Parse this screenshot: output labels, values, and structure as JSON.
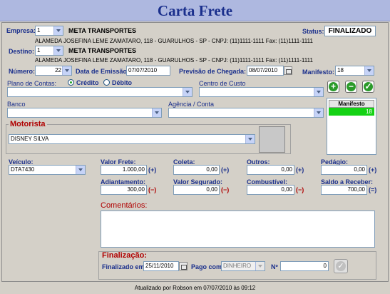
{
  "header": {
    "title": "Carta Frete"
  },
  "status": {
    "label": "Status:",
    "value": "FINALIZADO"
  },
  "empresa": {
    "label": "Empresa:",
    "code": "1",
    "name": "META TRANSPORTES",
    "address": "ALAMEDA JOSEFINA LEME ZAMATARO, 118 - GUARULHOS - SP - CNPJ: (11)1111-1111 Fax: (11)1111-1111"
  },
  "destino": {
    "label": "Destino:",
    "code": "1",
    "name": "META TRANSPORTES",
    "address": "ALAMEDA JOSEFINA LEME ZAMATARO, 118 - GUARULHOS - SP - CNPJ: (11)1111-1111 Fax: (11)1111-1111"
  },
  "numero": {
    "label": "Número:",
    "value": "22"
  },
  "emissao": {
    "label": "Data de Emissão:",
    "value": "07/07/2010"
  },
  "previsao": {
    "label": "Previsão de Chegada:",
    "value": "08/07/2010"
  },
  "manifesto_field": {
    "label": "Manifesto:",
    "value": "18"
  },
  "plano": {
    "label": "Plano de Contas:",
    "credito": "Crédito",
    "debito": "Débito",
    "selected": "Crédito",
    "value": ""
  },
  "centro": {
    "label": "Centro de Custo",
    "value": ""
  },
  "banco": {
    "label": "Banco",
    "value": ""
  },
  "agencia": {
    "label": "Agência / Conta",
    "value": ""
  },
  "manifesto_list": {
    "header": "Manifesto",
    "rows": [
      "18"
    ]
  },
  "motorista": {
    "title": "Motorista",
    "value": "DISNEY SILVA"
  },
  "veiculo": {
    "label": "Veículo:",
    "value": "DTA7430"
  },
  "valor_frete": {
    "label": "Valor Frete:",
    "value": "1.000,00",
    "op": "(+)"
  },
  "coleta": {
    "label": "Coleta:",
    "value": "0,00",
    "op": "(+)"
  },
  "outros": {
    "label": "Outros:",
    "value": "0,00",
    "op": "(+)"
  },
  "pedagio": {
    "label": "Pedágio:",
    "value": "0,00",
    "op": "(+)"
  },
  "adiantamento": {
    "label": "Adiantamento:",
    "value": "300,00",
    "op": "(−)"
  },
  "valor_segurado": {
    "label": "Valor Segurado:",
    "value": "0,00",
    "op": "(−)"
  },
  "combustivel": {
    "label": "Combustível:",
    "value": "0,00",
    "op": "(−)"
  },
  "saldo": {
    "label": "Saldo a Receber:",
    "value": "700,00",
    "op": "(=)"
  },
  "comentarios": {
    "title": "Comentários:",
    "value": ""
  },
  "finalizacao": {
    "title": "Finalização:",
    "finalizado_label": "Finalizado em:",
    "finalizado_value": "25/11/2010",
    "pago_label": "Pago com:",
    "pago_value": "DINHEIRO",
    "numero_label": "Nº",
    "numero_value": "0"
  },
  "footer": {
    "text": "Atualizado por Robson em 07/07/2010 às 09:12"
  },
  "colors": {
    "accent": "#1a2f8c",
    "red": "#b00000",
    "green": "#2a9a2a",
    "title_bg": "#aeb8e0"
  }
}
